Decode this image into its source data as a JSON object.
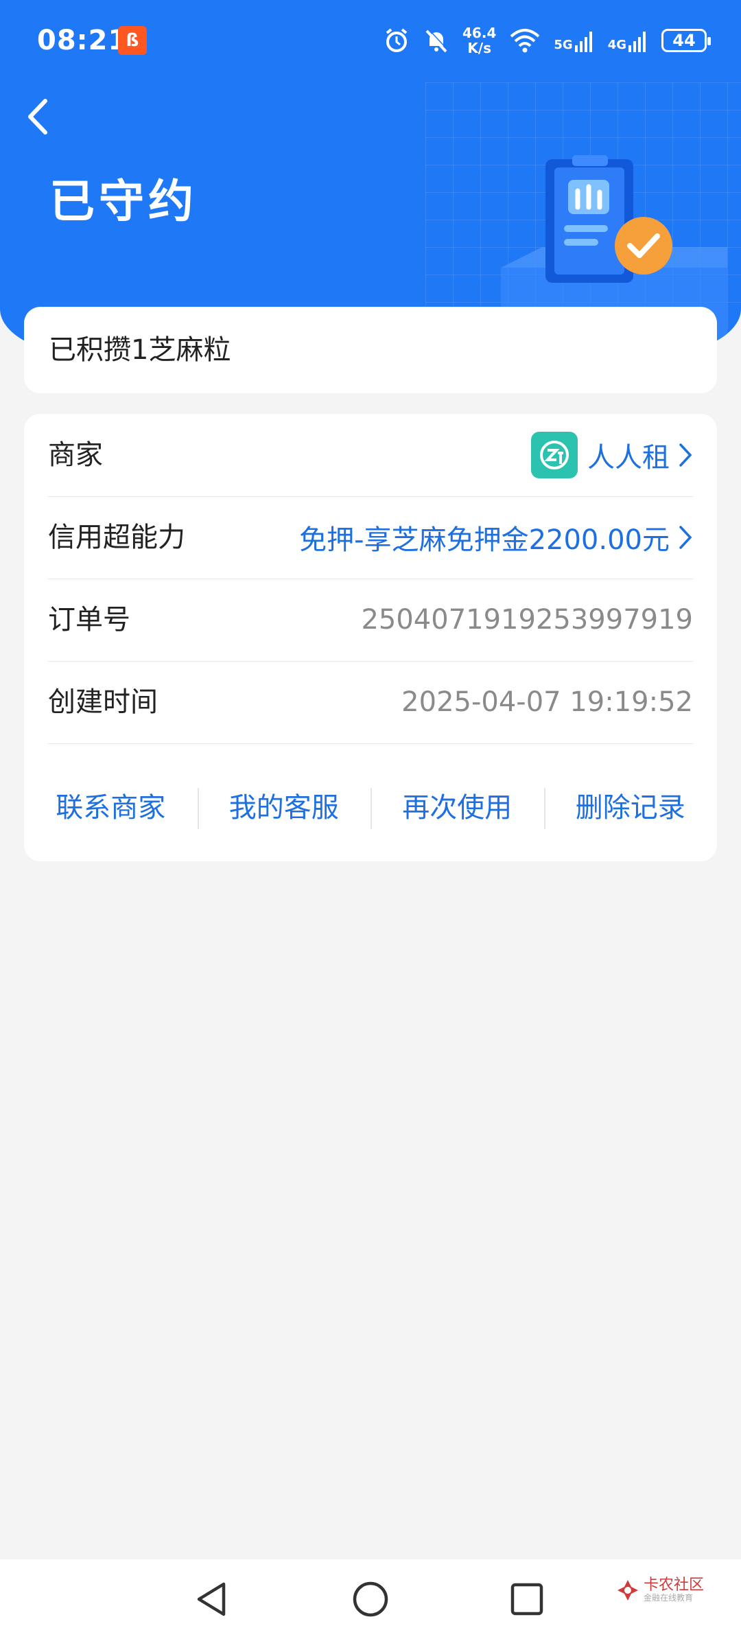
{
  "status_bar": {
    "time": "08:21",
    "app_badge": "ß",
    "net_speed_value": "46.4",
    "net_speed_unit": "K/s",
    "net_5g": "5G",
    "net_4g": "4G",
    "battery": "44"
  },
  "header": {
    "title": "已守约"
  },
  "points": {
    "text": "已积攒1芝麻粒"
  },
  "order": {
    "merchant_label": "商家",
    "merchant_name": "人人租",
    "credit_label": "信用超能力",
    "credit_value": "免押-享芝麻免押金2200.00元",
    "order_no_label": "订单号",
    "order_no_value": "2504071919253997919",
    "created_label": "创建时间",
    "created_value": "2025-04-07 19:19:52"
  },
  "actions": {
    "contact_merchant": "联系商家",
    "my_service": "我的客服",
    "use_again": "再次使用",
    "delete_record": "删除记录"
  },
  "watermark": {
    "title": "卡农社区",
    "subtitle": "金融在线教育"
  },
  "colors": {
    "header_blue": "#1f78f6",
    "link_blue": "#1e6fe0",
    "check_orange": "#f5a03a",
    "merchant_teal": "#2bc3b0"
  }
}
